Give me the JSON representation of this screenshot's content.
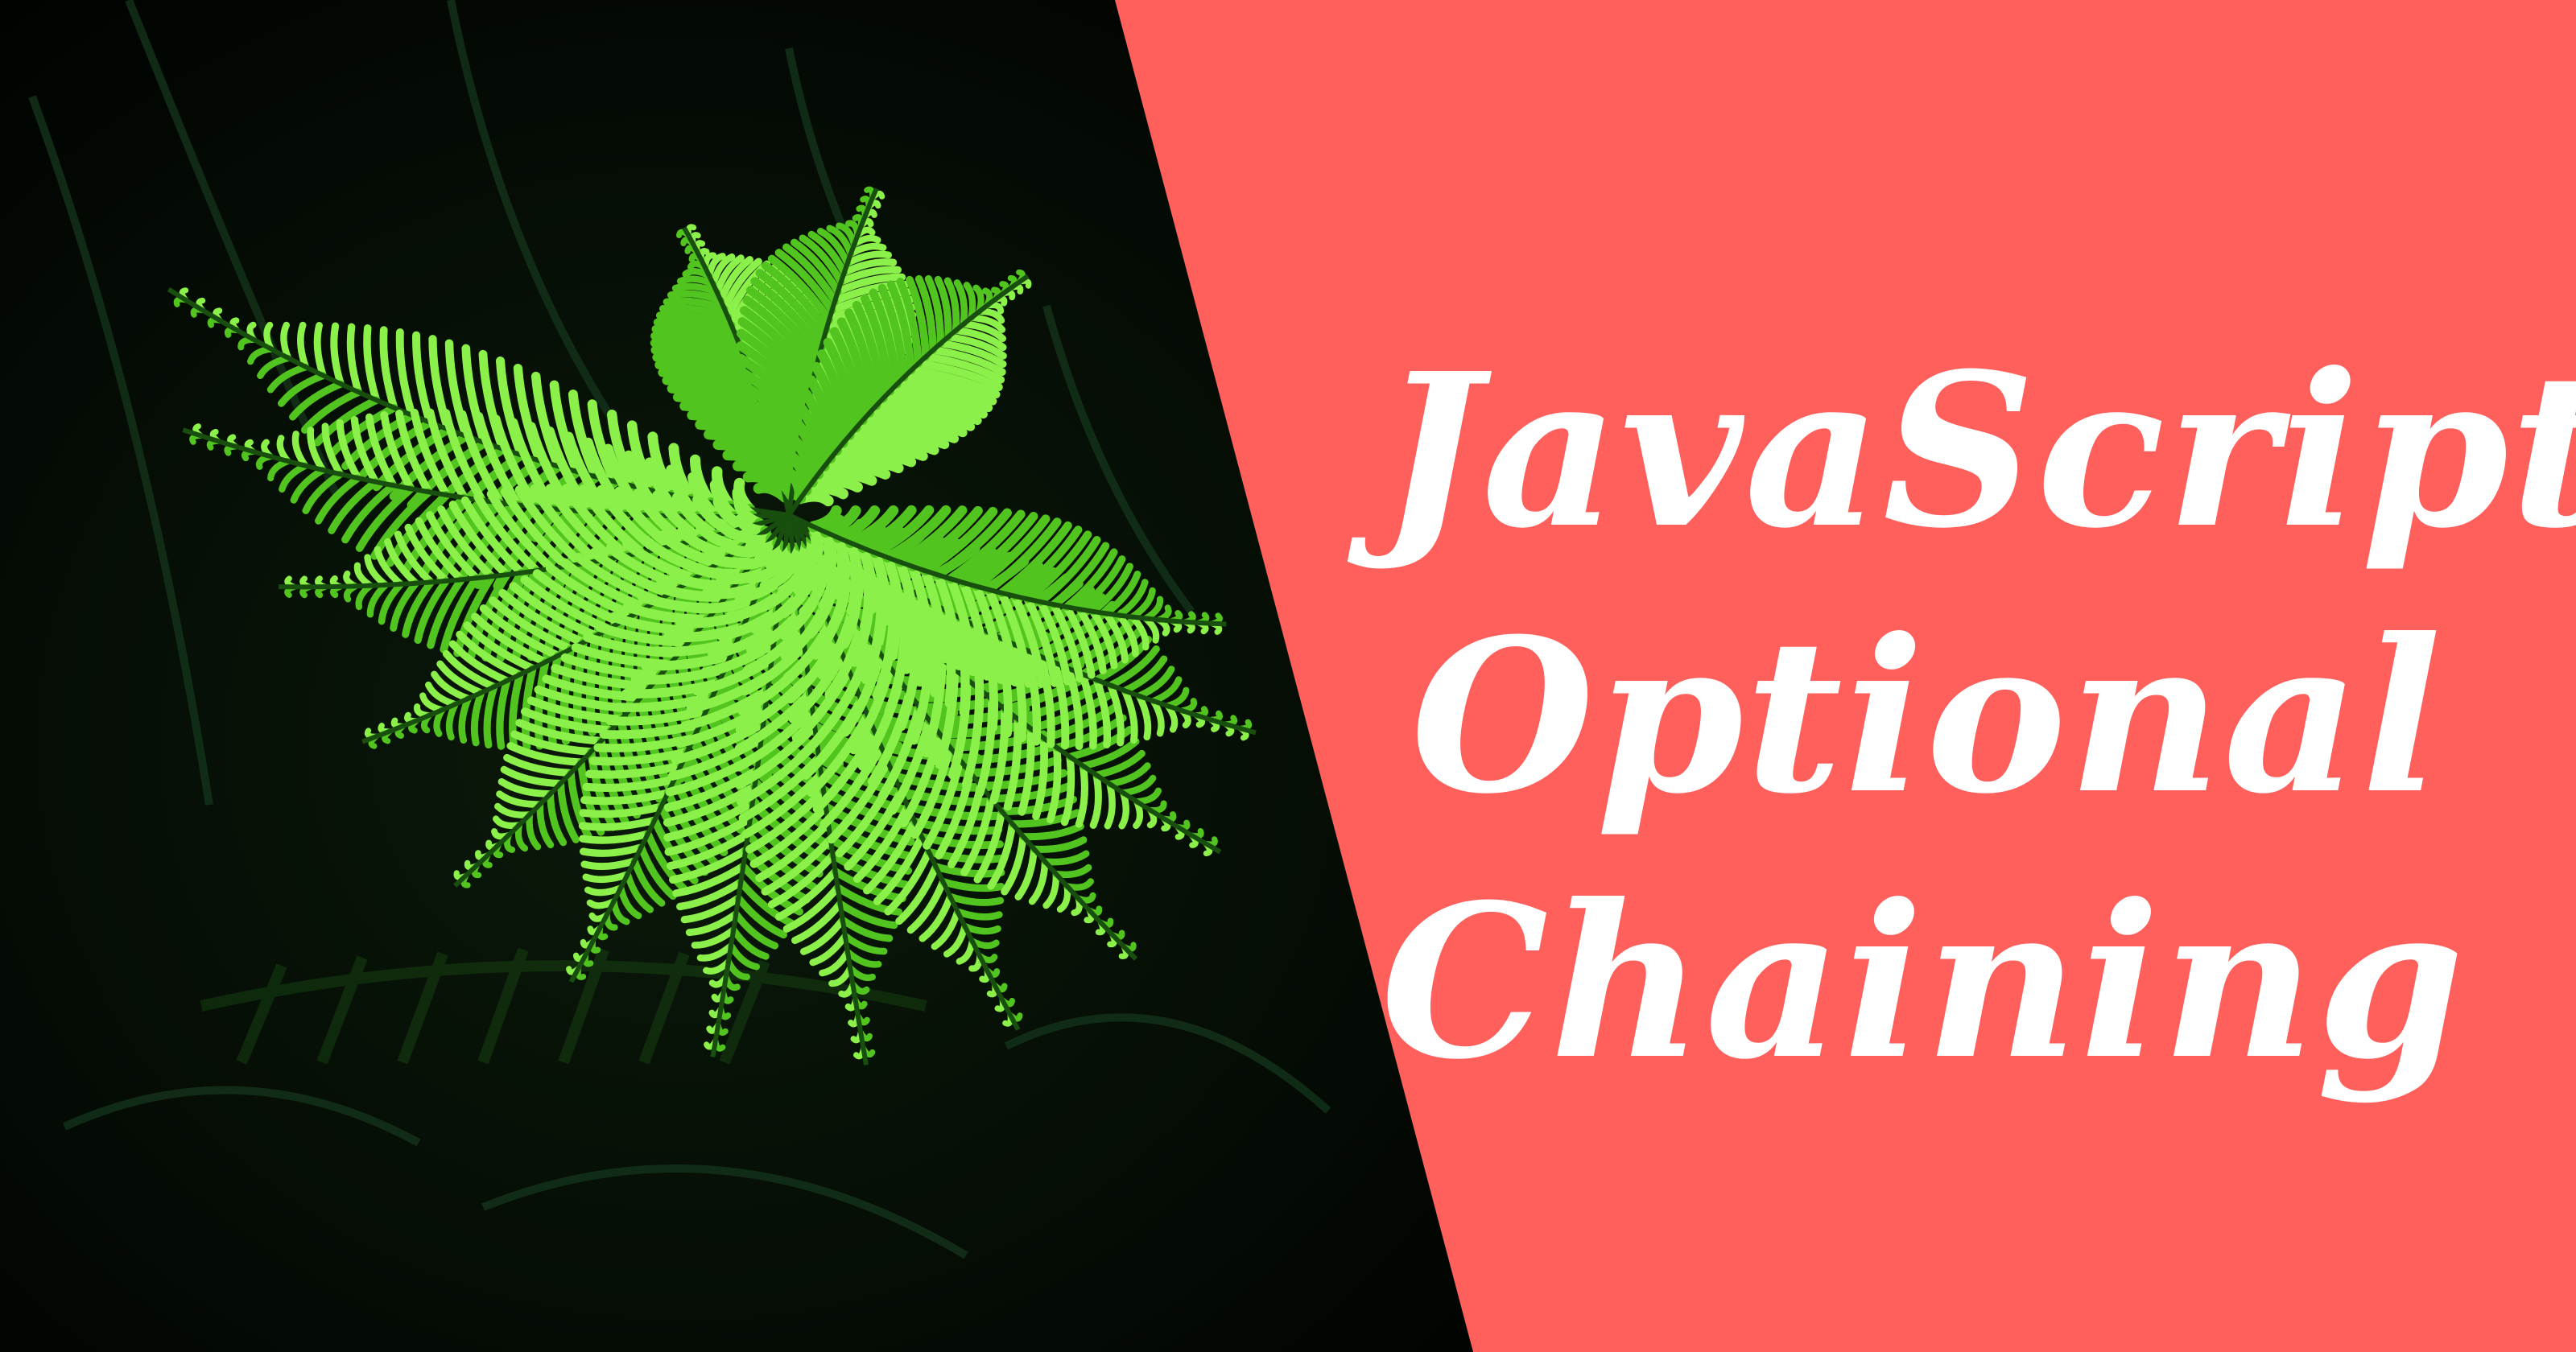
{
  "title_lines": [
    "JavaScript",
    "Optional",
    "Chaining"
  ],
  "colors": {
    "accent_panel": "#ff605c",
    "title_text": "#ffffff",
    "background": "#030803",
    "fern_light": "#8cf04a",
    "fern_mid": "#52c41f",
    "fern_dark": "#184f0e"
  },
  "image": {
    "subject": "fern-photo",
    "icon": "fern-leaf"
  }
}
